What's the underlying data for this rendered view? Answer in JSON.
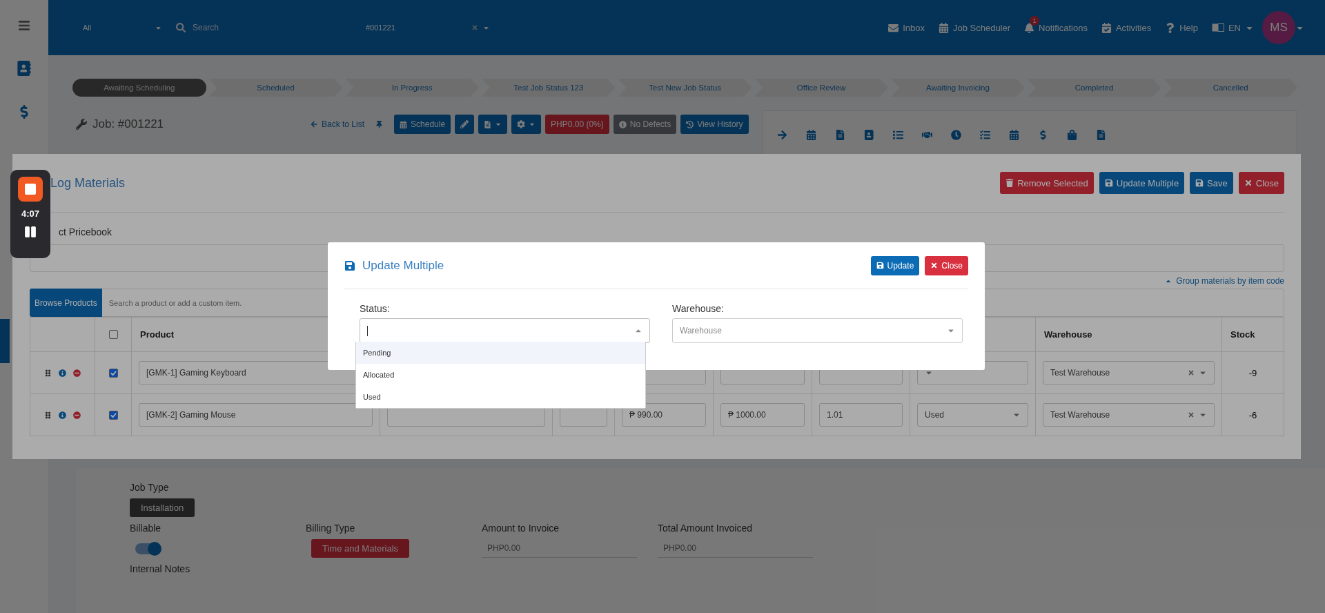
{
  "topbar": {
    "scope": "All",
    "search_placeholder": "Search",
    "job_value": "#001221",
    "nav": [
      {
        "label": "Inbox"
      },
      {
        "label": "Job Scheduler"
      },
      {
        "label": "Notifications",
        "badge": "1"
      },
      {
        "label": "Activities"
      },
      {
        "label": "Help"
      }
    ],
    "language": "EN",
    "avatar": "MS"
  },
  "steps": [
    {
      "label": "Awaiting Scheduling",
      "selected": true
    },
    {
      "label": "Scheduled",
      "selected": false
    },
    {
      "label": "In Progress",
      "selected": false
    },
    {
      "label": "Test Job Status 123",
      "selected": false
    },
    {
      "label": "Test New Job Status",
      "selected": false
    },
    {
      "label": "Office Review",
      "selected": false
    },
    {
      "label": "Awaiting Invoicing",
      "selected": false
    },
    {
      "label": "Completed",
      "selected": false
    },
    {
      "label": "Cancelled",
      "selected": false
    }
  ],
  "job": {
    "title": "Job: #001221",
    "back": "Back to List",
    "schedule": "Schedule",
    "amount": "PHP0.00 (0%)",
    "defects": "No Defects",
    "history": "View History"
  },
  "log_modal": {
    "title": "Log Materials",
    "actions": [
      {
        "label": "Remove Selected",
        "kind": "danger"
      },
      {
        "label": "Update Multiple",
        "kind": "primary"
      },
      {
        "label": "Save",
        "kind": "primary"
      },
      {
        "label": "Close",
        "kind": "danger"
      }
    ],
    "pricebook_label": "ct Pricebook",
    "group_link": "Group materials by item code",
    "browse": "Browse Products",
    "search_placeholder": "Search a product or add a custom item.",
    "table": {
      "select_all": {
        "checked": false
      },
      "columns": {
        "product": "Product",
        "warehouse": "Warehouse",
        "stock": "Stock"
      },
      "rows": [
        {
          "checked": true,
          "product": "[GMK-1] Gaming Keyboard",
          "warehouse": "Test Warehouse",
          "stock": "-9"
        },
        {
          "checked": true,
          "product": "[GMK-2] Gaming Mouse",
          "cost": "₱ 990.00",
          "price": "₱ 1000.00",
          "quantity": "1.01",
          "status": "Used",
          "warehouse": "Test Warehouse",
          "stock": "-6"
        }
      ]
    }
  },
  "update_modal": {
    "title": "Update Multiple",
    "update": "Update",
    "close": "Close",
    "status_label": "Status:",
    "warehouse_label": "Warehouse:",
    "warehouse_placeholder": "Warehouse",
    "status_options": [
      {
        "label": "Pending",
        "selected": true
      },
      {
        "label": "Allocated",
        "selected": false
      },
      {
        "label": "Used",
        "selected": false
      }
    ]
  },
  "recorder": {
    "time": "4:07"
  },
  "details": {
    "job_type_label": "Job Type",
    "job_type": "Installation",
    "billable_label": "Billable",
    "billable_on": true,
    "billing_type_label": "Billing Type",
    "billing_type": "Time and Materials",
    "amount_label": "Amount to Invoice",
    "amount": "PHP0.00",
    "total_label": "Total Amount Invoiced",
    "total": "PHP0.00",
    "notes_label": "Internal Notes"
  }
}
